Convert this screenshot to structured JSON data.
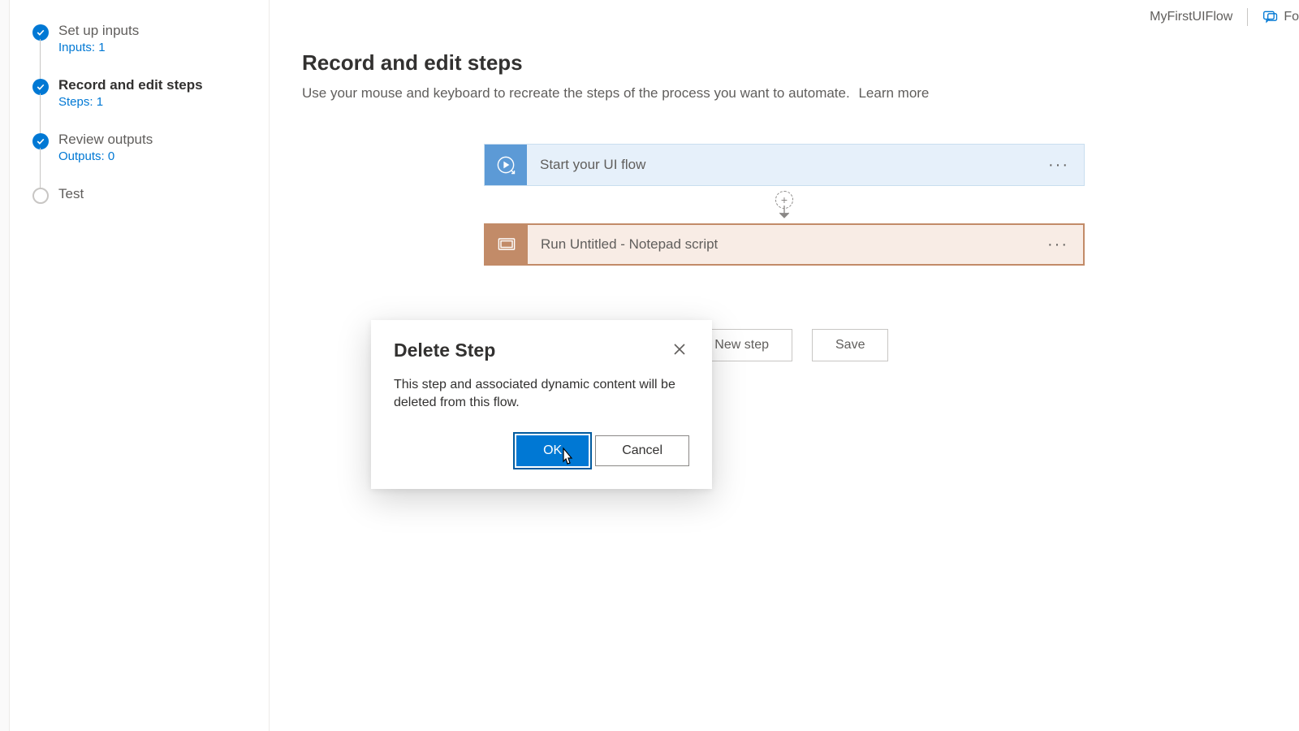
{
  "topbar": {
    "flow_name": "MyFirstUIFlow",
    "right_label": "Fo"
  },
  "sidebar": {
    "items": [
      {
        "label": "Set up inputs",
        "sub": "Inputs: 1"
      },
      {
        "label": "Record and edit steps",
        "sub": "Steps: 1"
      },
      {
        "label": "Review outputs",
        "sub": "Outputs: 0"
      },
      {
        "label": "Test",
        "sub": ""
      }
    ]
  },
  "page": {
    "title": "Record and edit steps",
    "subtitle": "Use your mouse and keyboard to recreate the steps of the process you want to automate.",
    "learn_more": "Learn more"
  },
  "cards": {
    "start": "Start your UI flow",
    "run": "Run Untitled - Notepad script"
  },
  "actions": {
    "new_step": "+ New step",
    "save": "Save"
  },
  "dialog": {
    "title": "Delete Step",
    "body": "This step and associated dynamic content will be deleted from this flow.",
    "ok": "OK",
    "cancel": "Cancel"
  }
}
